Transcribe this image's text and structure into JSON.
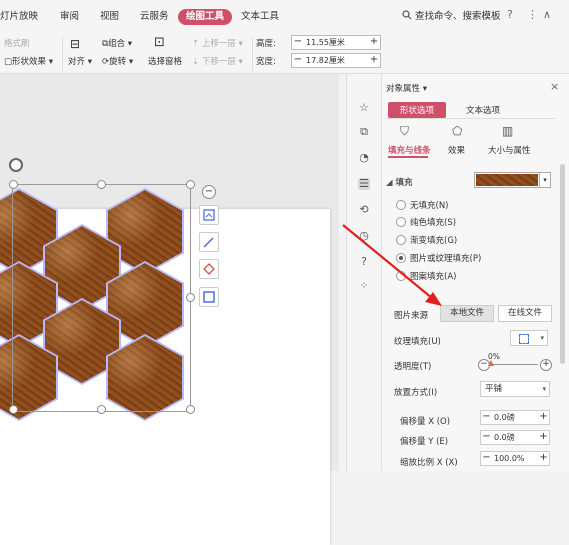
{
  "menu": {
    "items": [
      "灯片放映",
      "审阅",
      "视图",
      "云服务",
      "绘图工具",
      "文本工具"
    ],
    "active": "绘图工具",
    "search_label": "查找命令、搜索模板",
    "help": "?",
    "more": "⋮",
    "collapse": "∧"
  },
  "ribbon": {
    "format_brush": "格式刷",
    "shape_effect": "形状效果",
    "align": "对齐",
    "group": "组合",
    "rotate": "旋转",
    "select_pane": "选择窗格",
    "bring_forward": "上移一层",
    "send_backward": "下移一层",
    "height_label": "高度:",
    "height_value": "11.55厘米",
    "width_label": "宽度:",
    "width_value": "17.82厘米",
    "minus": "−",
    "plus": "+"
  },
  "panel": {
    "title": "对象属性",
    "close": "×",
    "tabs": [
      "形状选项",
      "文本选项"
    ],
    "subtabs": [
      "填充与线条",
      "效果",
      "大小与属性"
    ],
    "fill_section": "填充",
    "fill_options": [
      "无填充(N)",
      "纯色填充(S)",
      "渐变填充(G)",
      "图片或纹理填充(P)",
      "图案填充(A)"
    ],
    "selected_fill": "图片或纹理填充(P)",
    "picture_source_label": "图片来源",
    "local_file_button": "本地文件",
    "online_file_button": "在线文件",
    "texture_fill_label": "纹理填充(U)",
    "transparency_label": "透明度(T)",
    "transparency_value": "0%",
    "placement_label": "放置方式(I)",
    "placement_value": "平铺",
    "offset_x_label": "偏移量 X (O)",
    "offset_x_value": "0.0磅",
    "offset_y_label": "偏移量 Y (E)",
    "offset_y_value": "0.0磅",
    "scale_x_label": "缩放比例 X (X)",
    "scale_x_value": "100.0%"
  },
  "colors": {
    "accent": "#d0506a",
    "arrow": "#e02020",
    "hex_outline": "#b8b8ff",
    "leather": "#8a4a1c"
  }
}
